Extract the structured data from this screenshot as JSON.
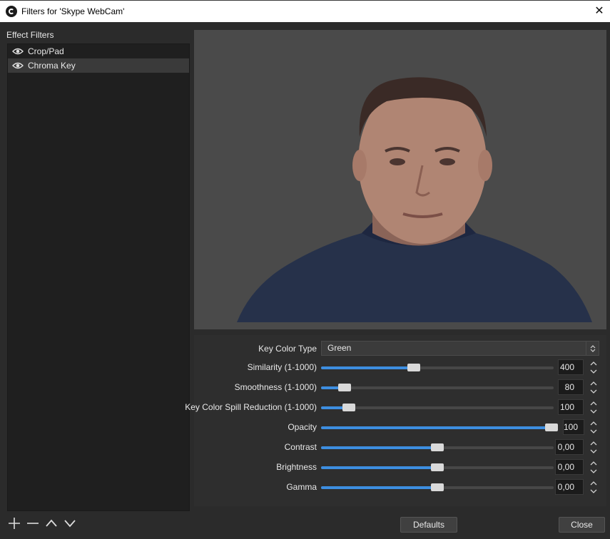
{
  "window": {
    "title": "Filters for 'Skype WebCam'",
    "close_glyph": "✕"
  },
  "filters": {
    "heading": "Effect Filters",
    "items": [
      {
        "label": "Crop/Pad",
        "selected": false
      },
      {
        "label": "Chroma Key",
        "selected": true
      }
    ]
  },
  "properties": {
    "key_color_type": {
      "label": "Key Color Type",
      "value": "Green"
    },
    "sliders": [
      {
        "label": "Similarity (1-1000)",
        "value": "400",
        "fraction": 0.4
      },
      {
        "label": "Smoothness (1-1000)",
        "value": "80",
        "fraction": 0.1
      },
      {
        "label": "Key Color Spill Reduction (1-1000)",
        "value": "100",
        "fraction": 0.12
      },
      {
        "label": "Opacity",
        "value": "100",
        "fraction": 1.0
      },
      {
        "label": "Contrast",
        "value": "0,00",
        "fraction": 0.5
      },
      {
        "label": "Brightness",
        "value": "0,00",
        "fraction": 0.5
      },
      {
        "label": "Gamma",
        "value": "0,00",
        "fraction": 0.5
      }
    ]
  },
  "buttons": {
    "defaults": "Defaults",
    "close": "Close"
  },
  "icons": {
    "visibility": "eye-icon",
    "add": "plus-icon",
    "remove": "minus-icon",
    "up": "chevron-up-icon",
    "down": "chevron-down-icon"
  },
  "colors": {
    "accent": "#3d8ee0",
    "background": "#2b2b2b",
    "preview_bg": "#4a4a4a"
  }
}
